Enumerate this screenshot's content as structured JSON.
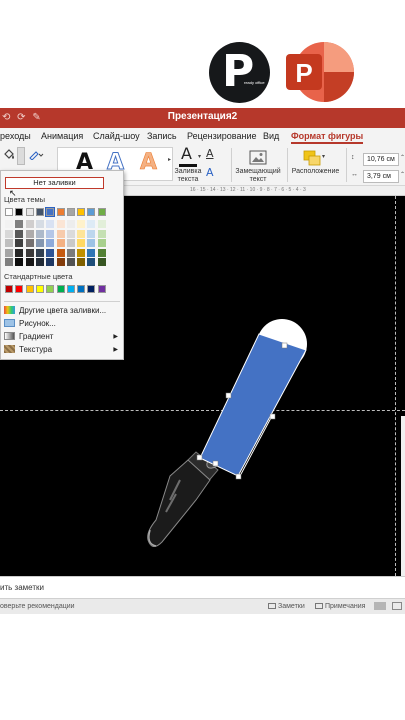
{
  "branding": {
    "logo_letter": "P",
    "logo_small_text": "ready office",
    "powerpoint_letter": "P"
  },
  "window": {
    "title": "Презентация2"
  },
  "tabs": [
    {
      "label": "реходы",
      "active": false
    },
    {
      "label": "Анимация",
      "active": false
    },
    {
      "label": "Слайд-шоу",
      "active": false
    },
    {
      "label": "Запись",
      "active": false
    },
    {
      "label": "Рецензирование",
      "active": false
    },
    {
      "label": "Вид",
      "active": false
    },
    {
      "label": "Формат фигуры",
      "active": true
    }
  ],
  "ribbon": {
    "fill_text_line1": "Заливка",
    "fill_text_line2": "текста",
    "alt_text_line1": "Замещающий",
    "alt_text_line2": "текст",
    "arrange_label": "Расположение",
    "height_value": "10,76 см",
    "width_value": "3,79 см",
    "wordart_glyph": "A"
  },
  "ruler": {
    "ticks": "16 · 15 · 14 · 13 · 12 · 11 · 10 · 9 · 8 · 7 · 6 · 5 · 4 · 3"
  },
  "fill_menu": {
    "no_fill": "Нет заливки",
    "theme_colors_header": "Цвета темы",
    "standard_colors_header": "Стандартные цвета",
    "theme_top_row": [
      "#ffffff",
      "#000000",
      "#e7e6e6",
      "#44546a",
      "#4472c4",
      "#ed7d31",
      "#a5a5a5",
      "#ffc000",
      "#5b9bd5",
      "#70ad47"
    ],
    "theme_shades": [
      [
        "#f2f2f2",
        "#7f7f7f",
        "#d0cece",
        "#d6dce4",
        "#d9e2f3",
        "#fbe5d5",
        "#ededed",
        "#fff2cc",
        "#deebf6",
        "#e2efd9"
      ],
      [
        "#d8d8d8",
        "#595959",
        "#aeabab",
        "#adb9ca",
        "#b4c6e7",
        "#f7cbac",
        "#dbdbdb",
        "#fee599",
        "#bdd7ee",
        "#c5e0b3"
      ],
      [
        "#bfbfbf",
        "#3f3f3f",
        "#757070",
        "#8496b0",
        "#8eaadb",
        "#f4b183",
        "#c9c9c9",
        "#ffd965",
        "#9dc3e6",
        "#a8d08d"
      ],
      [
        "#a5a5a5",
        "#262626",
        "#3a3838",
        "#323f4f",
        "#2f5496",
        "#c55a11",
        "#7b7b7b",
        "#bf9000",
        "#2e75b5",
        "#538135"
      ],
      [
        "#7f7f7f",
        "#0c0c0c",
        "#171616",
        "#222a35",
        "#1f3864",
        "#833c0b",
        "#525252",
        "#7f6000",
        "#1e4e79",
        "#375623"
      ]
    ],
    "standard_colors": [
      "#c00000",
      "#ff0000",
      "#ffc000",
      "#ffff00",
      "#92d050",
      "#00b050",
      "#00b0f0",
      "#0070c0",
      "#002060",
      "#7030a0"
    ],
    "selected_color": "#4472c4",
    "items": [
      {
        "label": "Другие цвета заливки...",
        "submenu": false
      },
      {
        "label": "Рисунок...",
        "submenu": false
      },
      {
        "label": "Градиент",
        "submenu": true
      },
      {
        "label": "Текстура",
        "submenu": true
      }
    ]
  },
  "slide": {
    "shape_fill": "#4472c4",
    "background": "#000000"
  },
  "notes": {
    "label": "ить заметки"
  },
  "status": {
    "recommendations": "оверьте рекомендации",
    "notes_button": "Заметки",
    "comments_button": "Примечания"
  }
}
